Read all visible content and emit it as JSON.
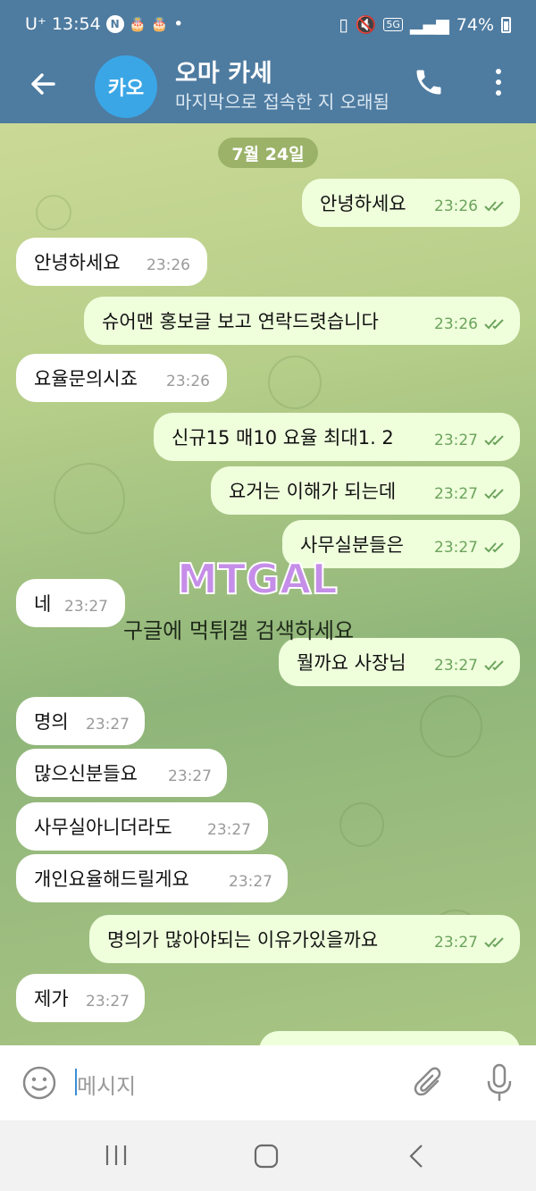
{
  "status_bar": {
    "carrier": "U⁺",
    "time": "13:54",
    "battery": "74%",
    "network": "5G"
  },
  "header": {
    "avatar_initials": "카오",
    "chat_name": "오마 카세",
    "chat_status": "마지막으로 접속한 지 오래됨"
  },
  "chat": {
    "date_label": "7월 24일",
    "messages": [
      {
        "dir": "out",
        "text": "안녕하세요",
        "time": "23:26"
      },
      {
        "dir": "in",
        "text": "안녕하세요",
        "time": "23:26"
      },
      {
        "dir": "out",
        "text": "슈어맨 홍보글 보고 연락드렷습니다",
        "time": "23:26"
      },
      {
        "dir": "in",
        "text": "요율문의시죠",
        "time": "23:26"
      },
      {
        "dir": "out",
        "text": "신규15 매10 요율 최대1. 2",
        "time": "23:27"
      },
      {
        "dir": "out",
        "text": "요거는 이해가 되는데",
        "time": "23:27"
      },
      {
        "dir": "out",
        "text": "사무실분들은",
        "time": "23:27"
      },
      {
        "dir": "in",
        "text": "네",
        "time": "23:27"
      },
      {
        "dir": "out",
        "text": "뭘까요 사장님",
        "time": "23:27"
      },
      {
        "dir": "in",
        "text": "명의",
        "time": "23:27"
      },
      {
        "dir": "in",
        "text": "많으신분들요",
        "time": "23:27"
      },
      {
        "dir": "in",
        "text": "사무실아니더라도",
        "time": "23:27"
      },
      {
        "dir": "in",
        "text": "개인요율해드릴게요",
        "time": "23:27"
      },
      {
        "dir": "out",
        "text": "명의가 많아야되는 이유가있을까요",
        "time": "23:27"
      },
      {
        "dir": "in",
        "text": "제가",
        "time": "23:27"
      }
    ],
    "watermark_logo": "MTGAL",
    "watermark_text": "구글에 먹튀갤 검색하세요"
  },
  "input": {
    "placeholder": "메시지"
  },
  "colors": {
    "header_bg": "#4e7ba0",
    "incoming_bubble": "#ffffff",
    "outgoing_bubble": "#efffdc",
    "check_color": "#6ca35c",
    "avatar_bg": "#3aa6e6"
  },
  "icons": {
    "back": "arrow-left-icon",
    "call": "phone-icon",
    "more": "more-vertical-icon",
    "emoji": "smiley-icon",
    "attach": "paperclip-icon",
    "mic": "microphone-icon"
  }
}
